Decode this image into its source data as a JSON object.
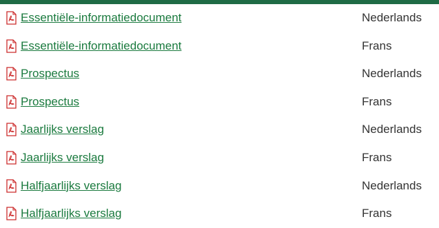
{
  "colors": {
    "accent_bar": "#1f6b45",
    "link": "#1a7a3e",
    "text": "#333333",
    "pdf_icon": "#cc2b2b"
  },
  "documents": [
    {
      "title": "Essentiële-informatiedocument",
      "language": "Nederlands",
      "icon": "pdf-icon"
    },
    {
      "title": "Essentiële-informatiedocument",
      "language": "Frans",
      "icon": "pdf-icon"
    },
    {
      "title": "Prospectus",
      "language": "Nederlands",
      "icon": "pdf-icon"
    },
    {
      "title": "Prospectus",
      "language": "Frans",
      "icon": "pdf-icon"
    },
    {
      "title": "Jaarlijks verslag",
      "language": "Nederlands",
      "icon": "pdf-icon"
    },
    {
      "title": "Jaarlijks verslag",
      "language": "Frans",
      "icon": "pdf-icon"
    },
    {
      "title": "Halfjaarlijks verslag",
      "language": "Nederlands",
      "icon": "pdf-icon"
    },
    {
      "title": "Halfjaarlijks verslag",
      "language": "Frans",
      "icon": "pdf-icon"
    }
  ]
}
